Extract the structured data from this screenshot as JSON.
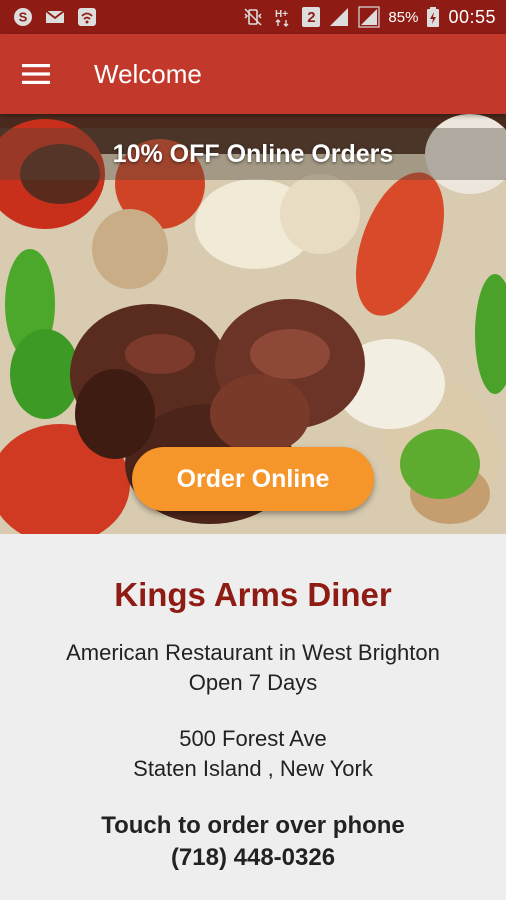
{
  "status_bar": {
    "left_icons": [
      "skype-icon",
      "mail-icon",
      "wifi-call-icon"
    ],
    "sim_badge": "2",
    "battery_percent": "85%",
    "time": "00:55"
  },
  "app_bar": {
    "title": "Welcome",
    "menu_icon": "hamburger-menu-icon"
  },
  "hero": {
    "promo_text": "10% OFF Online Orders",
    "order_button_label": "Order Online"
  },
  "restaurant": {
    "name": "Kings Arms Diner",
    "description_line1": "American Restaurant in West Brighton",
    "description_line2": "Open 7 Days",
    "address_line1": "500 Forest Ave",
    "address_line2": "Staten Island , New York",
    "phone_prompt": "Touch to order over phone",
    "phone": "(718) 448-0326"
  },
  "colors": {
    "status_bar": "#8e1c14",
    "app_bar": "#c2392b",
    "order_button": "#f5952a",
    "restaurant_name": "#8e1c14"
  }
}
